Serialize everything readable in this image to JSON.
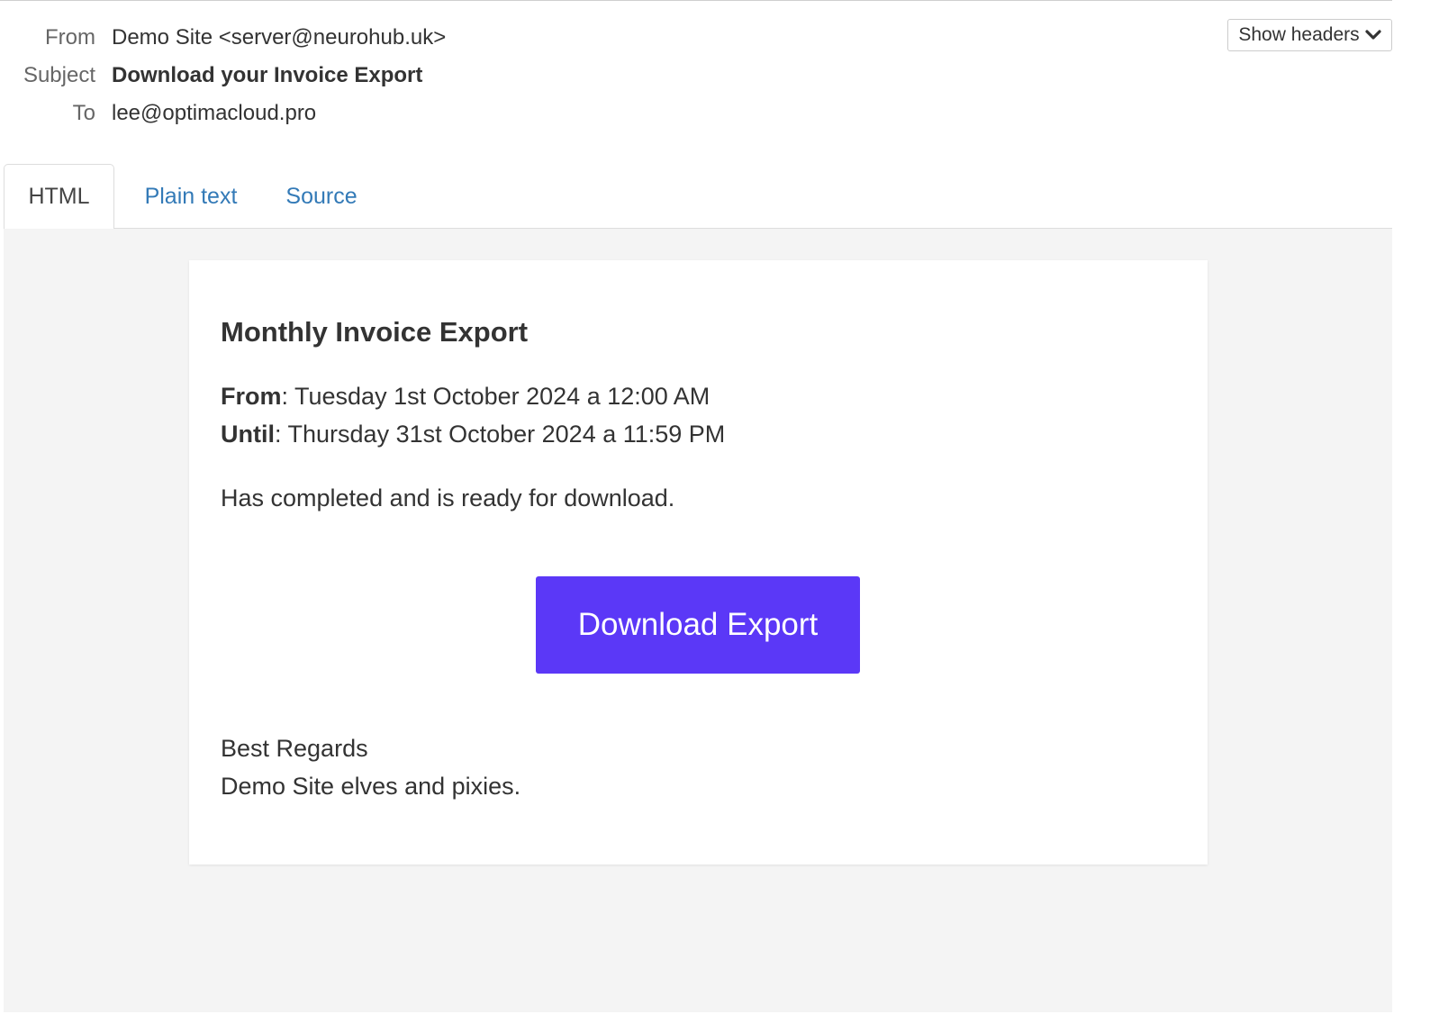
{
  "headers": {
    "from_label": "From",
    "from_value": "Demo Site <server@neurohub.uk>",
    "subject_label": "Subject",
    "subject_value": "Download your Invoice Export",
    "to_label": "To",
    "to_value": "lee@optimacloud.pro",
    "show_headers_label": "Show headers",
    "show_headers_icon": "chevron-down-icon"
  },
  "tabs": [
    {
      "label": "HTML",
      "active": true
    },
    {
      "label": "Plain text",
      "active": false
    },
    {
      "label": "Source",
      "active": false
    }
  ],
  "email": {
    "title": "Monthly Invoice Export",
    "from_label": "From",
    "from_value": ": Tuesday 1st October 2024 a 12:00 AM",
    "until_label": "Until",
    "until_value": ": Thursday 31st October 2024 a 11:59 PM",
    "status_text": "Has completed and is ready for download.",
    "button_label": "Download Export",
    "regards": "Best Regards",
    "signature": "Demo Site elves and pixies."
  },
  "colors": {
    "link": "#337ab7",
    "button_bg": "#5b38f7",
    "button_text": "#ffffff",
    "email_background": "#f4f4f4"
  }
}
